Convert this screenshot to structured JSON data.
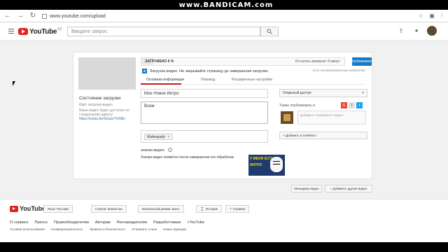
{
  "watermark": "www.BANDICAM.com",
  "browser": {
    "url": "www.youtube.com/upload"
  },
  "header": {
    "logo_text": "YouTube",
    "logo_region": "KZ",
    "search_placeholder": "Введите запрос"
  },
  "upload": {
    "status_title": "Состояние загрузки",
    "status_sub": "Идет загрузка видео.",
    "status_link_text": "Ваше видео будет доступно по следующему адресу:",
    "status_link_url": "https://youtu.be/nZupxYVS8ic",
    "progress_label": "ЗАГРУЖЕНО 6 %",
    "progress_fraction": 0.06,
    "remaining": "Осталось времени: 8 минут",
    "publish_label": "Опубликовать",
    "notice": "Загрузка видео. Не закрывайте страницу до завершения загрузки.",
    "saved_note": "Есть неопубликованные изменения.",
    "tabs": [
      "Основная информация",
      "Перевод",
      "Расширенные настройки"
    ],
    "title_value": "Мое Новое Интро",
    "description_value": "Всем",
    "tag": "Майнкрафт",
    "tag_remove": "×",
    "access": "Открытый доступ",
    "share_label": "Также опубликовать в",
    "share_placeholder": "Добавьте сообщение к видео",
    "playlist_label": "+ Добавить в плейлист",
    "icons_heading": "значки видео",
    "icons_note": "Значки видео появятся после завершения его обработки.",
    "icon_thumb_line1": "У МЕНЯ ЕСТЬ",
    "icon_thumb_line2": "ИНТРО",
    "video_manager": "Менеджер видео",
    "add_more": "+ Добавить другие видео"
  },
  "footer": {
    "logo_text": "YouTube",
    "language": "Язык: Русский",
    "country": "Страна: Казахстан",
    "safe_mode": "Безопасный режим: выкл.",
    "history": "История",
    "help": "Справка",
    "links1": [
      "О сервисе",
      "Прессе",
      "Правообладателям",
      "Авторам",
      "Рекламодателям",
      "Разработчикам",
      "+YouTube"
    ],
    "links2": [
      "Условия использования",
      "Конфиденциальность",
      "Правила и безопасность",
      "Отправить отзыв",
      "Новые функции"
    ]
  }
}
